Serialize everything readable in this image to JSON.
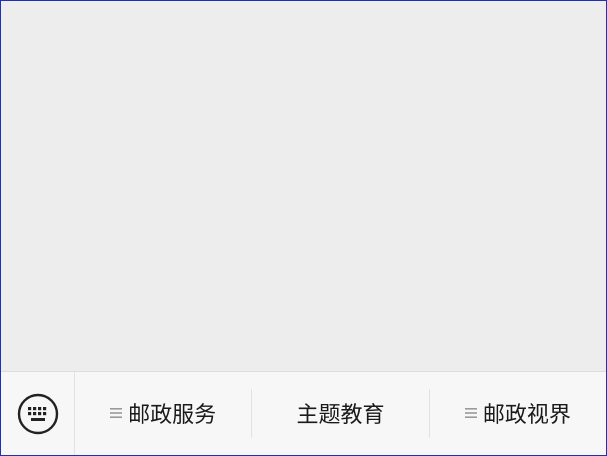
{
  "bottom_menu": {
    "items": [
      {
        "label": "邮政服务",
        "has_submenu": true,
        "icon": "menu-lines-icon"
      },
      {
        "label": "主题教育",
        "has_submenu": false
      },
      {
        "label": "邮政视界",
        "has_submenu": true,
        "icon": "menu-lines-icon"
      }
    ],
    "keyboard_icon": "keyboard-icon"
  },
  "colors": {
    "content_bg": "#ededed",
    "bar_bg": "#f7f7f7",
    "text": "#1a1a1a",
    "frame_border": "#1f2fb8"
  }
}
